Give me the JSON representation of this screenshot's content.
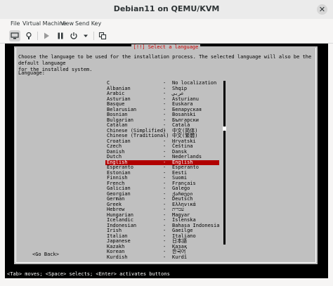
{
  "window": {
    "title": "Debian11 on QEMU/KVM",
    "close_glyph": "✕"
  },
  "menu": [
    "File",
    "Virtual Machine",
    "View",
    "Send Key"
  ],
  "toolbar": {
    "icons": [
      "console-icon",
      "details-icon",
      "run-icon",
      "pause-icon",
      "power-icon",
      "dropdown-icon",
      "snapshot-icon"
    ]
  },
  "installer": {
    "title": "[!!] Select a language",
    "description": "Choose the language to be used for the installation process. The selected language will also be the default language\nfor the installed system.",
    "language_label": "Language:",
    "languages": [
      {
        "name": "C",
        "native": "No localization"
      },
      {
        "name": "Albanian",
        "native": "Shqip"
      },
      {
        "name": "Arabic",
        "native": "عربي"
      },
      {
        "name": "Asturian",
        "native": "Asturianu"
      },
      {
        "name": "Basque",
        "native": "Euskara"
      },
      {
        "name": "Belarusian",
        "native": "Беларуская"
      },
      {
        "name": "Bosnian",
        "native": "Bosanski"
      },
      {
        "name": "Bulgarian",
        "native": "Български"
      },
      {
        "name": "Catalan",
        "native": "Català"
      },
      {
        "name": "Chinese (Simplified)",
        "native": "中文(简体)"
      },
      {
        "name": "Chinese (Traditional)",
        "native": "中文(繁體)"
      },
      {
        "name": "Croatian",
        "native": "Hrvatski"
      },
      {
        "name": "Czech",
        "native": "Čeština"
      },
      {
        "name": "Danish",
        "native": "Dansk"
      },
      {
        "name": "Dutch",
        "native": "Nederlands"
      },
      {
        "name": "English",
        "native": "English"
      },
      {
        "name": "Esperanto",
        "native": "Esperanto"
      },
      {
        "name": "Estonian",
        "native": "Eesti"
      },
      {
        "name": "Finnish",
        "native": "Suomi"
      },
      {
        "name": "French",
        "native": "Français"
      },
      {
        "name": "Galician",
        "native": "Galego"
      },
      {
        "name": "Georgian",
        "native": "ქართული"
      },
      {
        "name": "German",
        "native": "Deutsch"
      },
      {
        "name": "Greek",
        "native": "Ελληνικά"
      },
      {
        "name": "Hebrew",
        "native": "עברית"
      },
      {
        "name": "Hungarian",
        "native": "Magyar"
      },
      {
        "name": "Icelandic",
        "native": "Íslenska"
      },
      {
        "name": "Indonesian",
        "native": "Bahasa Indonesia"
      },
      {
        "name": "Irish",
        "native": "Gaeilge"
      },
      {
        "name": "Italian",
        "native": "Italiano"
      },
      {
        "name": "Japanese",
        "native": "日本語"
      },
      {
        "name": "Kazakh",
        "native": "Қазақ"
      },
      {
        "name": "Korean",
        "native": "한국어"
      },
      {
        "name": "Kurdish",
        "native": "Kurdî"
      }
    ],
    "selected": "English",
    "separator": "-",
    "go_back": "<Go Back>"
  },
  "status_bar": "<Tab> moves; <Space> selects; <Enter> activates buttons",
  "colors": {
    "selection": "#b10000",
    "title_text": "#cc0000",
    "dialog_bg": "#c0c0c0"
  }
}
